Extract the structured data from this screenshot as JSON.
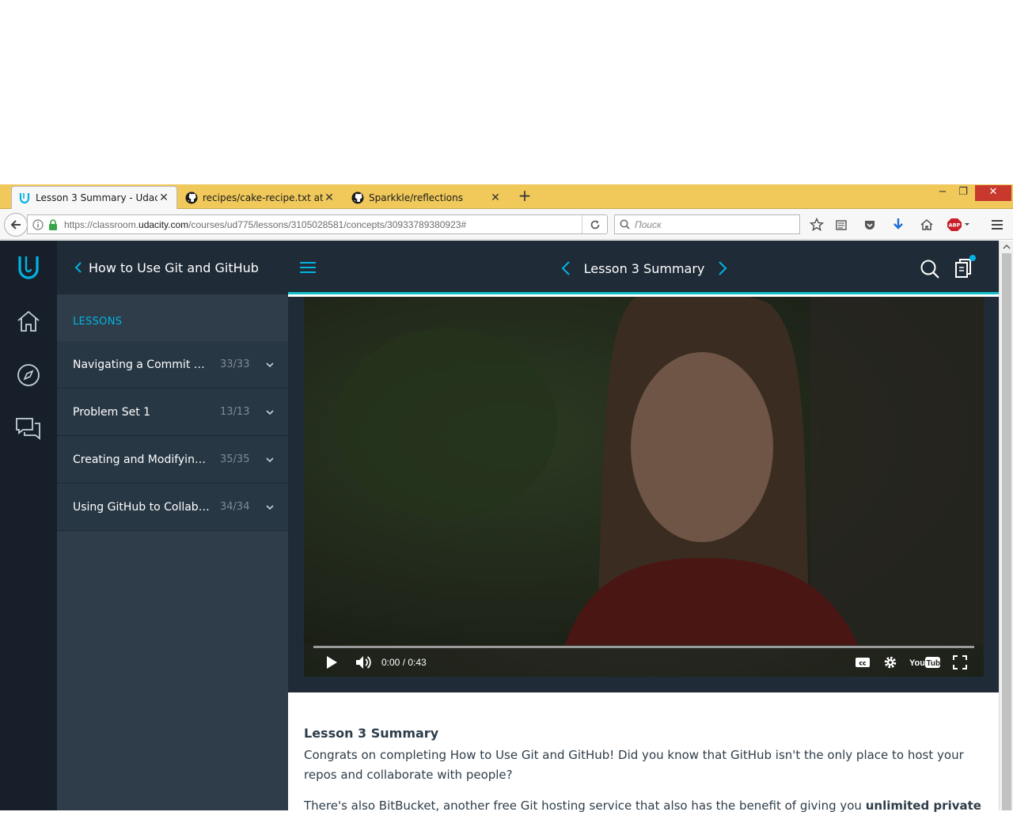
{
  "browser": {
    "tabs": [
      {
        "title": "Lesson 3 Summary - Udac...",
        "active": true,
        "favicon": "udacity-icon"
      },
      {
        "title": "recipes/cake-recipe.txt at ...",
        "active": false,
        "favicon": "github-icon"
      },
      {
        "title": "Sparkkle/reflections",
        "active": false,
        "favicon": "github-icon"
      }
    ],
    "url_prefix": "https://classroom.",
    "url_domain": "udacity.com",
    "url_path": "/courses/ud775/lessons/3105028581/concepts/30933789380923#",
    "search_placeholder": "Поиск",
    "abp_label": "ABP"
  },
  "sidebar": {
    "course_title": "How to Use Git and GitHub",
    "lessons_label": "LESSONS",
    "lessons": [
      {
        "title": "Navigating a Commit His...",
        "count": "33/33"
      },
      {
        "title": "Problem Set 1",
        "count": "13/13"
      },
      {
        "title": "Creating and Modifying ...",
        "count": "35/35"
      },
      {
        "title": "Using GitHub to Collabo...",
        "count": "34/34"
      }
    ]
  },
  "header": {
    "concept_title": "Lesson 3 Summary"
  },
  "video": {
    "time": "0:00 / 0:43",
    "played_fraction": 0
  },
  "content": {
    "heading": "Lesson 3 Summary",
    "p1": "Congrats on completing How to Use Git and GitHub! Did you know that GitHub isn't the only place to host your repos and collaborate with people?",
    "p2_start": "There's also BitBucket, another free Git hosting service that also has the benefit of giving you ",
    "p2_bold": "unlimited private"
  },
  "colors": {
    "accent": "#02b3e4",
    "teal_bar": "#15c0c9",
    "rail": "#17202a",
    "sidebar": "#2e3d49"
  }
}
